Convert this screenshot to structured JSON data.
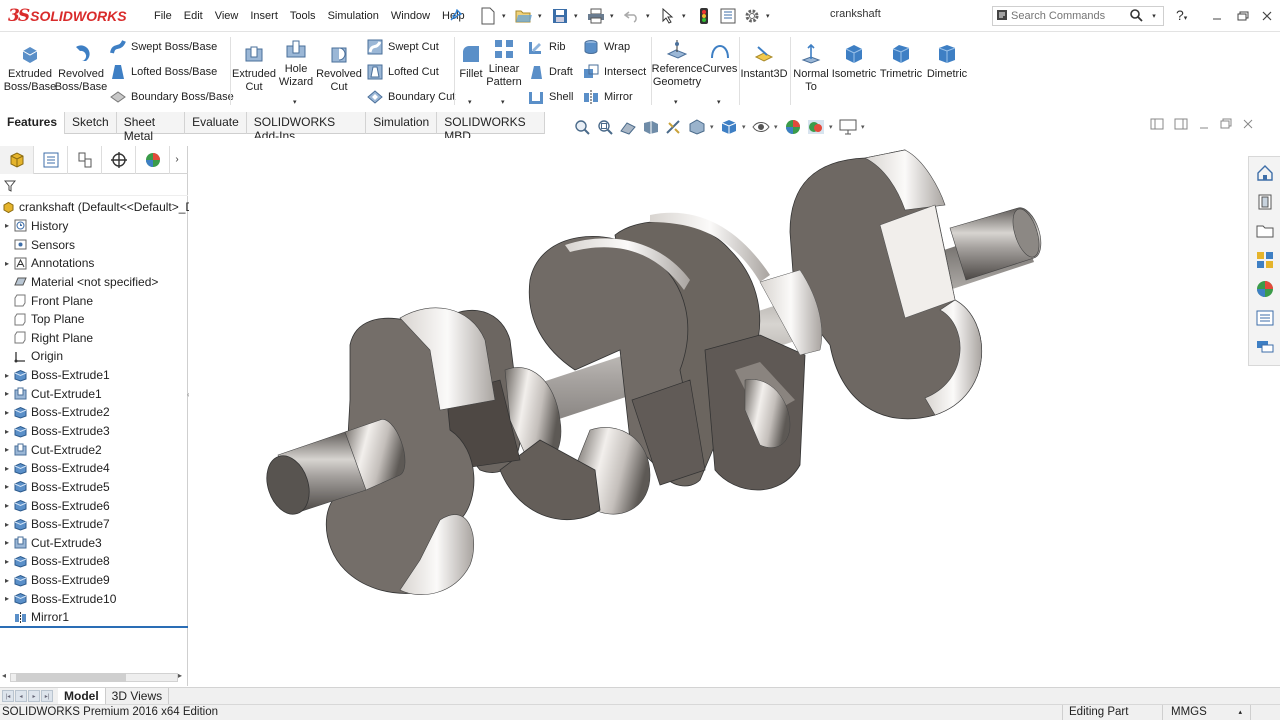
{
  "app": {
    "logo_mark": "3S",
    "logo_text": "SOLIDWORKS",
    "document_title": "crankshaft",
    "brand_color": "#d92b2b"
  },
  "menu": [
    "File",
    "Edit",
    "View",
    "Insert",
    "Tools",
    "Simulation",
    "Window",
    "Help"
  ],
  "search": {
    "placeholder": "Search Commands"
  },
  "ribbon": {
    "extruded_boss": "Extruded Boss/Base",
    "revolved_boss": "Revolved Boss/Base",
    "swept_boss": "Swept Boss/Base",
    "lofted_boss": "Lofted Boss/Base",
    "boundary_boss": "Boundary Boss/Base",
    "extruded_cut": "Extruded Cut",
    "hole_wizard": "Hole Wizard",
    "revolved_cut": "Revolved Cut",
    "swept_cut": "Swept Cut",
    "lofted_cut": "Lofted Cut",
    "boundary_cut": "Boundary Cut",
    "fillet": "Fillet",
    "linear_pattern": "Linear Pattern",
    "rib": "Rib",
    "draft": "Draft",
    "shell": "Shell",
    "wrap": "Wrap",
    "intersect": "Intersect",
    "mirror": "Mirror",
    "reference_geometry": "Reference Geometry",
    "curves": "Curves",
    "instant3d": "Instant3D",
    "normal_to": "Normal To",
    "isometric": "Isometric",
    "trimetric": "Trimetric",
    "dimetric": "Dimetric"
  },
  "command_tabs": [
    "Features",
    "Sketch",
    "Sheet Metal",
    "Evaluate",
    "SOLIDWORKS Add-Ins",
    "Simulation",
    "SOLIDWORKS MBD"
  ],
  "feature_tree": {
    "root": "crankshaft  (Default<<Default>_D",
    "items": [
      {
        "label": "History",
        "icon": "history-icon",
        "expandable": true
      },
      {
        "label": "Sensors",
        "icon": "sensors-icon",
        "expandable": false
      },
      {
        "label": "Annotations",
        "icon": "annotations-icon",
        "expandable": true
      },
      {
        "label": "Material <not specified>",
        "icon": "material-icon",
        "expandable": false
      },
      {
        "label": "Front Plane",
        "icon": "plane-icon",
        "expandable": false
      },
      {
        "label": "Top Plane",
        "icon": "plane-icon",
        "expandable": false
      },
      {
        "label": "Right Plane",
        "icon": "plane-icon",
        "expandable": false
      },
      {
        "label": "Origin",
        "icon": "origin-icon",
        "expandable": false
      },
      {
        "label": "Boss-Extrude1",
        "icon": "boss-extrude-icon",
        "expandable": true
      },
      {
        "label": "Cut-Extrude1",
        "icon": "cut-extrude-icon",
        "expandable": true
      },
      {
        "label": "Boss-Extrude2",
        "icon": "boss-extrude-icon",
        "expandable": true
      },
      {
        "label": "Boss-Extrude3",
        "icon": "boss-extrude-icon",
        "expandable": true
      },
      {
        "label": "Cut-Extrude2",
        "icon": "cut-extrude-icon",
        "expandable": true
      },
      {
        "label": "Boss-Extrude4",
        "icon": "boss-extrude-icon",
        "expandable": true
      },
      {
        "label": "Boss-Extrude5",
        "icon": "boss-extrude-icon",
        "expandable": true
      },
      {
        "label": "Boss-Extrude6",
        "icon": "boss-extrude-icon",
        "expandable": true
      },
      {
        "label": "Boss-Extrude7",
        "icon": "boss-extrude-icon",
        "expandable": true
      },
      {
        "label": "Cut-Extrude3",
        "icon": "cut-extrude-icon",
        "expandable": true
      },
      {
        "label": "Boss-Extrude8",
        "icon": "boss-extrude-icon",
        "expandable": true
      },
      {
        "label": "Boss-Extrude9",
        "icon": "boss-extrude-icon",
        "expandable": true
      },
      {
        "label": "Boss-Extrude10",
        "icon": "boss-extrude-icon",
        "expandable": true
      },
      {
        "label": "Mirror1",
        "icon": "mirror-icon",
        "expandable": false
      }
    ]
  },
  "bottom_tabs": [
    "Model",
    "3D Views"
  ],
  "status": {
    "edition": "SOLIDWORKS Premium 2016 x64 Edition",
    "mode": "Editing Part",
    "units": "MMGS"
  }
}
